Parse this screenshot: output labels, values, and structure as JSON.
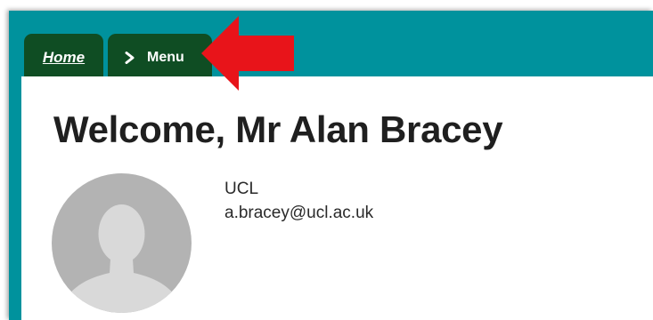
{
  "nav": {
    "home_label": "Home",
    "menu_label": "Menu"
  },
  "main": {
    "title": "Welcome, Mr Alan Bracey"
  },
  "profile": {
    "organization": "UCL",
    "email": "a.bracey@ucl.ac.uk"
  },
  "colors": {
    "frame": "#00929d",
    "tab": "#0f4d23",
    "arrow": "#e8141a",
    "avatar": "#b3b3b3"
  },
  "icons": {
    "menu_chevron": "chevron-right-icon",
    "pointer": "red-arrow-left-icon",
    "avatar": "person-silhouette-icon"
  }
}
